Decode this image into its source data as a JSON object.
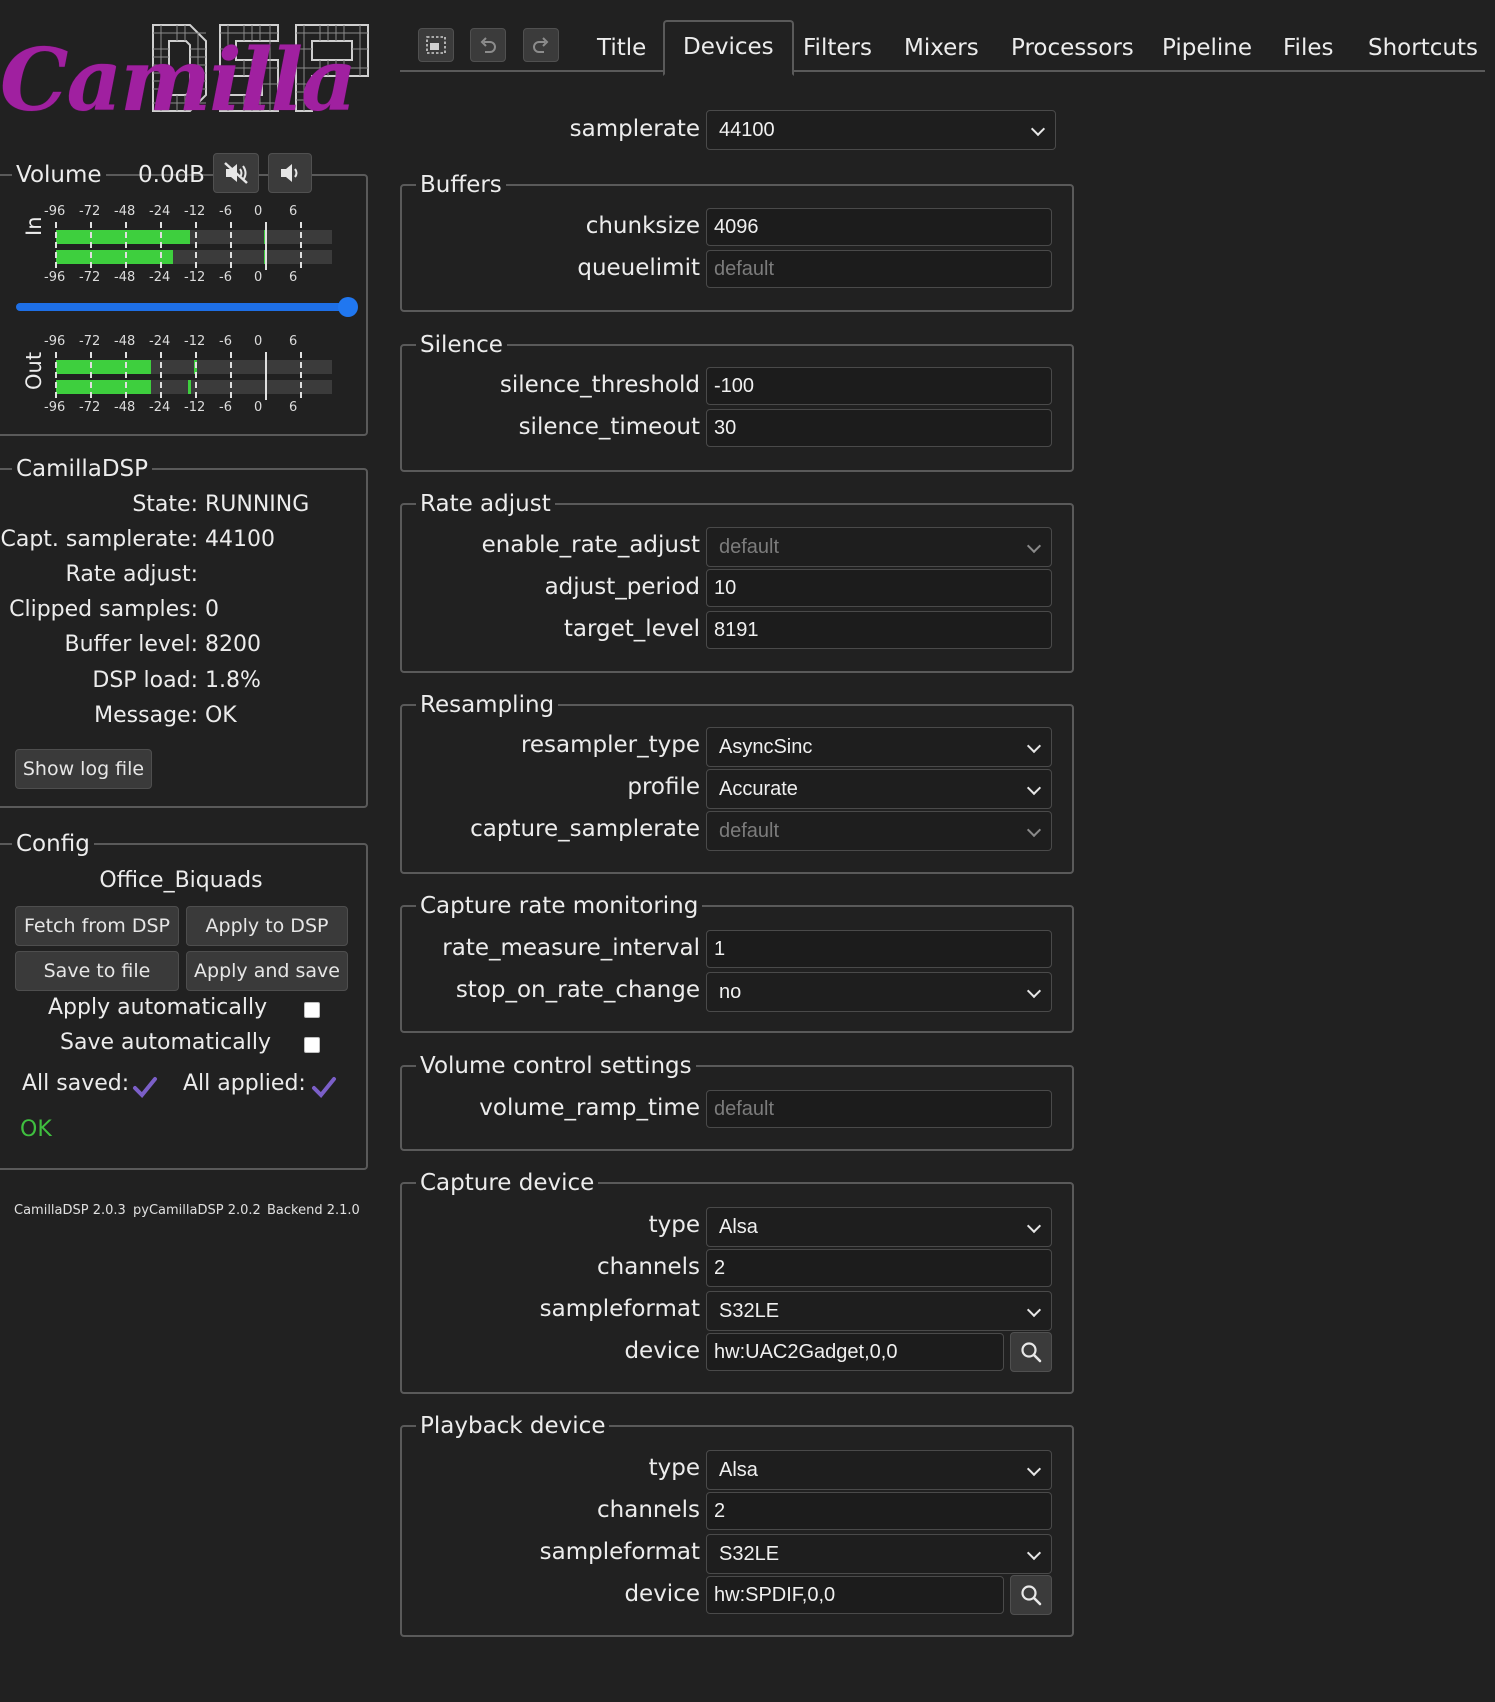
{
  "logo": {
    "text": "CamillaDSP"
  },
  "volume": {
    "label": "Volume",
    "value": "0.0dB",
    "slider_fraction": 1.0,
    "in_label": "In",
    "out_label": "Out",
    "scale_labels": [
      "-96",
      "-72",
      "-48",
      "-24",
      "-12",
      "-6",
      "0",
      "6"
    ],
    "in_levels_db": [
      -14,
      -20
    ],
    "in_peak_db": [
      0,
      0
    ],
    "out_levels_db": [
      -31,
      -31
    ],
    "out_peak_db": [
      -12,
      -14
    ]
  },
  "status": {
    "legend": "CamillaDSP",
    "rows": [
      {
        "label": "State:",
        "value": "RUNNING"
      },
      {
        "label": "Capt. samplerate:",
        "value": "44100"
      },
      {
        "label": "Rate adjust:",
        "value": ""
      },
      {
        "label": "Clipped samples:",
        "value": "0"
      },
      {
        "label": "Buffer level:",
        "value": "8200"
      },
      {
        "label": "DSP load:",
        "value": "1.8%"
      },
      {
        "label": "Message:",
        "value": "OK"
      }
    ],
    "show_log_label": "Show log file"
  },
  "config": {
    "legend": "Config",
    "name": "Office_Biquads",
    "fetch_label": "Fetch from DSP",
    "apply_label": "Apply to DSP",
    "save_label": "Save to file",
    "apply_save_label": "Apply and save",
    "apply_auto_label": "Apply automatically",
    "save_auto_label": "Save automatically",
    "all_saved_label": "All saved:",
    "all_applied_label": "All applied:",
    "message": "OK",
    "check_color": "#7b5fc8",
    "ok_color": "#3fbf3f"
  },
  "versions": {
    "camilladsp": "CamillaDSP 2.0.3",
    "pycamilladsp": "pyCamillaDSP 2.0.2",
    "backend": "Backend 2.1.0"
  },
  "tabs": [
    "Title",
    "Devices",
    "Filters",
    "Mixers",
    "Processors",
    "Pipeline",
    "Files",
    "Shortcuts"
  ],
  "active_tab": "Devices",
  "devices": {
    "samplerate": {
      "label": "samplerate",
      "value": "44100"
    },
    "buffers": {
      "legend": "Buffers",
      "chunksize": {
        "label": "chunksize",
        "value": "4096"
      },
      "queuelimit": {
        "label": "queuelimit",
        "placeholder": "default"
      }
    },
    "silence": {
      "legend": "Silence",
      "threshold": {
        "label": "silence_threshold",
        "value": "-100"
      },
      "timeout": {
        "label": "silence_timeout",
        "value": "30"
      }
    },
    "rate_adjust": {
      "legend": "Rate adjust",
      "enable": {
        "label": "enable_rate_adjust",
        "value": "default"
      },
      "period": {
        "label": "adjust_period",
        "value": "10"
      },
      "target": {
        "label": "target_level",
        "value": "8191"
      }
    },
    "resampling": {
      "legend": "Resampling",
      "type": {
        "label": "resampler_type",
        "value": "AsyncSinc"
      },
      "profile": {
        "label": "profile",
        "value": "Accurate"
      },
      "capture_samplerate": {
        "label": "capture_samplerate",
        "value": "default"
      }
    },
    "monitoring": {
      "legend": "Capture rate monitoring",
      "interval": {
        "label": "rate_measure_interval",
        "value": "1"
      },
      "stop": {
        "label": "stop_on_rate_change",
        "value": "no"
      }
    },
    "volume_control": {
      "legend": "Volume control settings",
      "ramp": {
        "label": "volume_ramp_time",
        "placeholder": "default"
      }
    },
    "capture": {
      "legend": "Capture device",
      "type": {
        "label": "type",
        "value": "Alsa"
      },
      "channels": {
        "label": "channels",
        "value": "2"
      },
      "format": {
        "label": "sampleformat",
        "value": "S32LE"
      },
      "device": {
        "label": "device",
        "value": "hw:UAC2Gadget,0,0"
      }
    },
    "playback": {
      "legend": "Playback device",
      "type": {
        "label": "type",
        "value": "Alsa"
      },
      "channels": {
        "label": "channels",
        "value": "2"
      },
      "format": {
        "label": "sampleformat",
        "value": "S32LE"
      },
      "device": {
        "label": "device",
        "value": "hw:SPDIF,0,0"
      }
    }
  }
}
